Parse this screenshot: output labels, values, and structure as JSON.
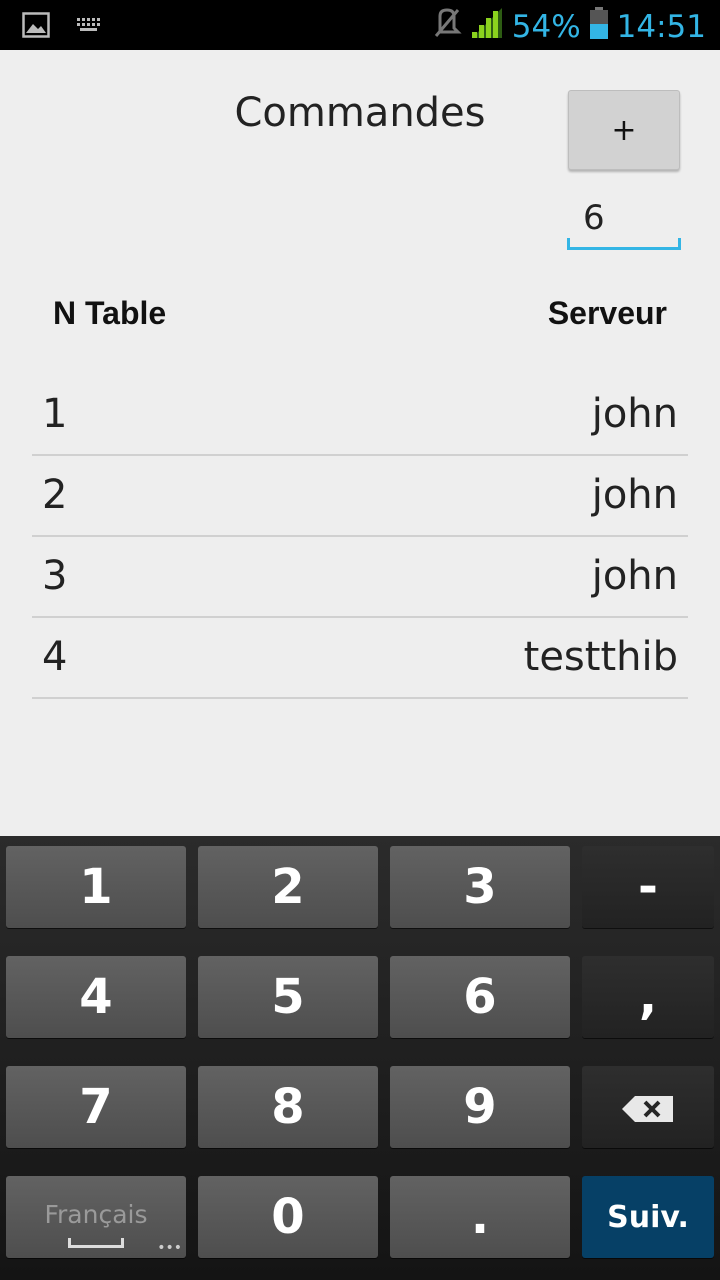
{
  "status_bar": {
    "left_icons": [
      "image-icon",
      "keyboard-icon"
    ],
    "right_icons": [
      "mute-icon",
      "signal-icon",
      "battery-icon"
    ],
    "battery_percent": "54%",
    "time": "14:51",
    "accent_color": "#33b5e5"
  },
  "header": {
    "title": "Commandes",
    "add_button_label": "+",
    "number_input_value": "6"
  },
  "table": {
    "columns": [
      "N Table",
      "Serveur"
    ],
    "rows": [
      {
        "num": "1",
        "server": "john"
      },
      {
        "num": "2",
        "server": "john"
      },
      {
        "num": "3",
        "server": "john"
      },
      {
        "num": "4",
        "server": "testthib"
      }
    ]
  },
  "keyboard": {
    "keys": [
      "1",
      "2",
      "3",
      "-",
      "4",
      "5",
      "6",
      ",",
      "7",
      "8",
      "9",
      "0",
      "."
    ],
    "language_label": "Français",
    "backspace_icon": "backspace-icon",
    "next_label": "Suiv.",
    "next_color": "#064066"
  }
}
